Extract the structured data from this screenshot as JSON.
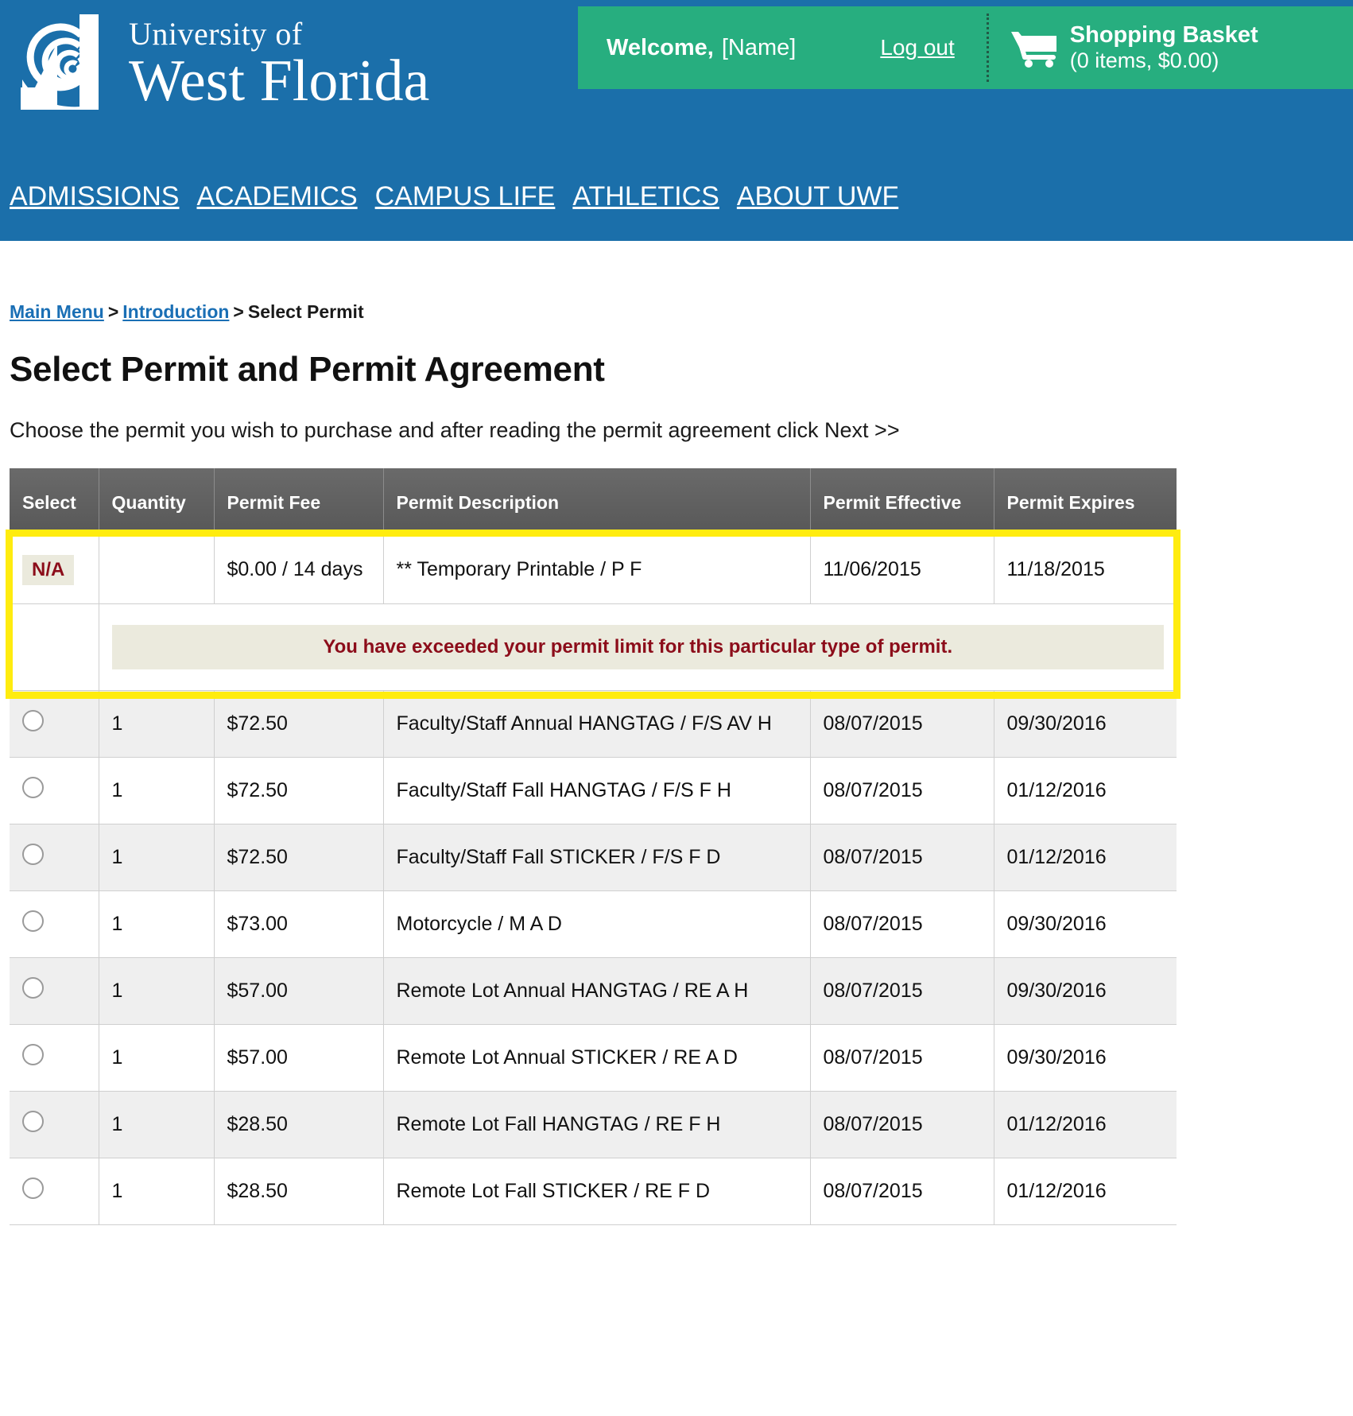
{
  "brand": {
    "university_line1": "University of",
    "university_line2": "West Florida",
    "logo_icon": "nautilus-shell-logo",
    "blue": "#1b6faa",
    "green": "#27ae7f"
  },
  "utility_bar": {
    "welcome_label": "Welcome,",
    "user_name": "[Name]",
    "logout_label": "Log out",
    "cart_icon": "shopping-cart-icon",
    "basket_title": "Shopping Basket",
    "basket_summary": "(0 items, $0.00)"
  },
  "main_nav": [
    {
      "label": "ADMISSIONS"
    },
    {
      "label": "ACADEMICS"
    },
    {
      "label": "CAMPUS LIFE"
    },
    {
      "label": "ATHLETICS"
    },
    {
      "label": "ABOUT UWF"
    }
  ],
  "breadcrumb": {
    "items": [
      {
        "label": "Main Menu",
        "link": true
      },
      {
        "label": "Introduction",
        "link": true
      },
      {
        "label": "Select Permit",
        "link": false
      }
    ],
    "separator": ">"
  },
  "page": {
    "title": "Select Permit and Permit Agreement",
    "instructions": "Choose the permit you wish to purchase and after reading the permit agreement click Next >>"
  },
  "table": {
    "headers": [
      "Select",
      "Quantity",
      "Permit Fee",
      "Permit Description",
      "Permit Effective",
      "Permit Expires"
    ],
    "na_row": {
      "select_label": "N/A",
      "quantity": "",
      "fee": "$0.00 / 14 days",
      "description": "** Temporary Printable / P F",
      "effective": "11/06/2015",
      "expires": "11/18/2015"
    },
    "warning_message": "You have exceeded your permit limit for this particular type of permit.",
    "rows": [
      {
        "quantity": "1",
        "fee": "$72.50",
        "description": "Faculty/Staff Annual HANGTAG / F/S AV H",
        "effective": "08/07/2015",
        "expires": "09/30/2016"
      },
      {
        "quantity": "1",
        "fee": "$72.50",
        "description": "Faculty/Staff Fall HANGTAG / F/S F H",
        "effective": "08/07/2015",
        "expires": "01/12/2016"
      },
      {
        "quantity": "1",
        "fee": "$72.50",
        "description": "Faculty/Staff Fall STICKER / F/S F D",
        "effective": "08/07/2015",
        "expires": "01/12/2016"
      },
      {
        "quantity": "1",
        "fee": "$73.00",
        "description": "Motorcycle / M A D",
        "effective": "08/07/2015",
        "expires": "09/30/2016"
      },
      {
        "quantity": "1",
        "fee": "$57.00",
        "description": "Remote Lot Annual HANGTAG / RE A H",
        "effective": "08/07/2015",
        "expires": "09/30/2016"
      },
      {
        "quantity": "1",
        "fee": "$57.00",
        "description": "Remote Lot Annual STICKER / RE A D",
        "effective": "08/07/2015",
        "expires": "09/30/2016"
      },
      {
        "quantity": "1",
        "fee": "$28.50",
        "description": "Remote Lot Fall HANGTAG / RE F H",
        "effective": "08/07/2015",
        "expires": "01/12/2016"
      },
      {
        "quantity": "1",
        "fee": "$28.50",
        "description": "Remote Lot Fall STICKER / RE F D",
        "effective": "08/07/2015",
        "expires": "01/12/2016"
      }
    ]
  },
  "annotation": {
    "highlight_color": "#ffec0f"
  }
}
